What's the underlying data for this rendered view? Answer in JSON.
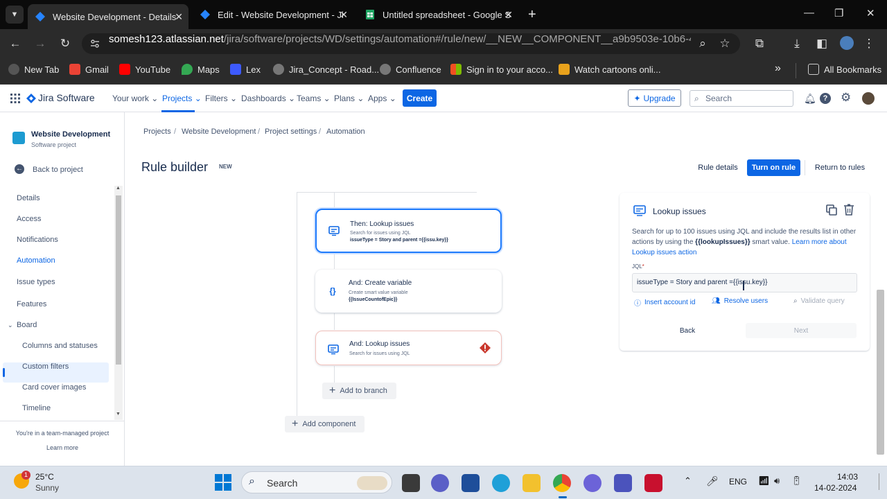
{
  "browser": {
    "tabs": [
      {
        "title": "Website Development - Details",
        "active": true
      },
      {
        "title": "Edit - Website Development - Ji",
        "active": false
      },
      {
        "title": "Untitled spreadsheet - Google S",
        "active": false
      }
    ],
    "new_tab": "+",
    "url_host": "somesh123.atlassian.net",
    "url_path": "/jira/software/projects/WD/settings/automation#/rule/new/__NEW__COMPONENT__a9b9503e-10b6-4a3c-913...",
    "bookmarks": [
      "New Tab",
      "Gmail",
      "YouTube",
      "Maps",
      "Lex",
      "Jira_Concept - Road...",
      "Confluence",
      "Sign in to your acco...",
      "Watch cartoons onli..."
    ],
    "more": "»",
    "all_bookmarks": "All Bookmarks"
  },
  "jira_nav": {
    "logo": "Jira Software",
    "items": [
      "Your work",
      "Projects",
      "Filters",
      "Dashboards",
      "Teams",
      "Plans",
      "Apps"
    ],
    "create": "Create",
    "upgrade": "Upgrade",
    "search_placeholder": "Search"
  },
  "sidebar": {
    "project_name": "Website Development",
    "project_type": "Software project",
    "back": "Back to project",
    "items": [
      "Details",
      "Access",
      "Notifications",
      "Automation",
      "Issue types",
      "Features",
      "Board"
    ],
    "sub_items": [
      "Columns and statuses",
      "Custom filters",
      "Card cover images",
      "Timeline"
    ],
    "footer_text": "You're in a team-managed project",
    "footer_link": "Learn more"
  },
  "breadcrumb": [
    "Projects",
    "Website Development",
    "Project settings",
    "Automation"
  ],
  "page": {
    "title": "Rule builder",
    "badge": "NEW",
    "rule_details": "Rule details",
    "turn_on": "Turn on rule",
    "return": "Return to rules"
  },
  "components": [
    {
      "title": "Then: Lookup issues",
      "desc": "Search for issues using JQL",
      "detail": "issueType = Story and parent ={{issu.key}}"
    },
    {
      "title": "And: Create variable",
      "desc": "Create smart value variable",
      "detail": "{{IssueCountofEpic}}"
    },
    {
      "title": "And: Lookup issues",
      "desc": "Search for issues using JQL",
      "detail": ""
    }
  ],
  "add_to_branch": "Add to branch",
  "add_component": "Add component",
  "panel": {
    "title": "Lookup issues",
    "desc_1": "Search for up to 100 issues using JQL and include the results list in other actions by using the ",
    "desc_smart": "{{lookupIssues}}",
    "desc_2": " smart value. ",
    "desc_link": "Learn more about Lookup issues action",
    "jql_label": "JQL",
    "jql_value": "issueType = Story and parent ={{issu.key}}",
    "insert_account": "Insert account id",
    "resolve_users": "Resolve users",
    "validate": "Validate query",
    "back": "Back",
    "next": "Next"
  },
  "taskbar": {
    "temp": "25°C",
    "weather": "Sunny",
    "search": "Search",
    "lang": "ENG",
    "time": "14:03",
    "date": "14-02-2024",
    "weather_badge": "1"
  },
  "colors": {
    "accent": "#0c66e4",
    "error": "#c9372c"
  }
}
